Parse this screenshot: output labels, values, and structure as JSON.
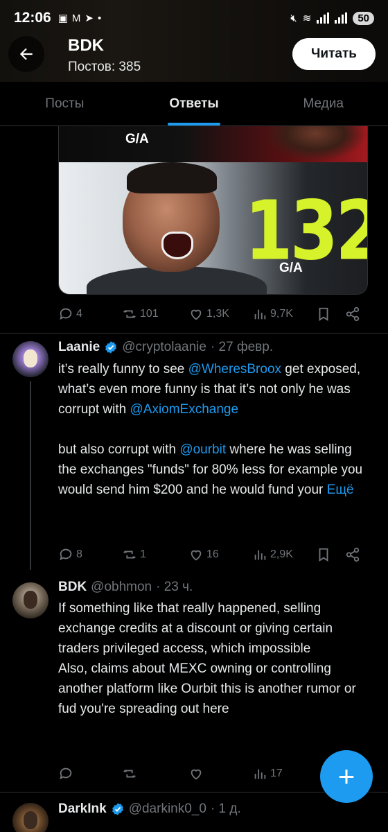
{
  "status_bar": {
    "time": "12:06",
    "battery": "50"
  },
  "header": {
    "name": "BDK",
    "posts": "Постов: 385",
    "follow_label": "Читать"
  },
  "tabs": [
    {
      "label": "Посты",
      "active": false
    },
    {
      "label": "Ответы",
      "active": true
    },
    {
      "label": "Медиа",
      "active": false
    }
  ],
  "media": {
    "top_label": "G/A",
    "big_number": "132",
    "bottom_label": "G/A"
  },
  "tweet1_actions": {
    "replies": "4",
    "reposts": "101",
    "likes": "1,3K",
    "views": "9,7K"
  },
  "tweet2": {
    "name": "Laanie",
    "handle": "@cryptolaanie",
    "time": "· 27 февр.",
    "p1_a": "it’s really funny to see ",
    "p1_m1": "@WheresBroox",
    "p1_b": " get exposed, what’s even more funny is that it’s not only he was corrupt with ",
    "p1_m2": "@AxiomExchange",
    "p2_a": "but also corrupt with ",
    "p2_m1": "@ourbit",
    "p2_b": " where he was selling the exchanges \"funds\" for 80% less for example you would send him $200 and he would fund your ",
    "more": "Ещё",
    "actions": {
      "replies": "8",
      "reposts": "1",
      "likes": "16",
      "views": "2,9K"
    }
  },
  "tweet3": {
    "name": "BDK",
    "handle": "@obhmon",
    "time": "· 23 ч.",
    "text": "If something like that really happened, selling exchange credits at a discount or giving certain traders privileged access, which impossible\nAlso, claims about MEXC owning or controlling another platform like Ourbit this is another rumor or fud you're spreading out here",
    "actions": {
      "views": "17"
    }
  },
  "tweet4": {
    "name": "DarkInk",
    "handle": "@darkink0_0",
    "time": "· 1 д."
  },
  "colors": {
    "accent": "#1d9bf0",
    "background": "#000000",
    "muted": "#71767b"
  },
  "fab": {
    "icon": "plus-icon"
  }
}
